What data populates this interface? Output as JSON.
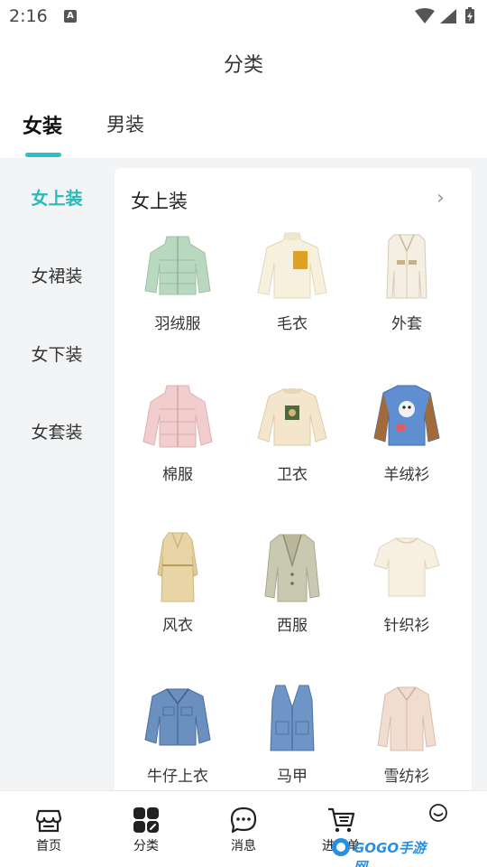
{
  "status_bar": {
    "time": "2:16",
    "notification_glyph": "A"
  },
  "header": {
    "title": "分类"
  },
  "tabs": [
    {
      "label": "女装",
      "active": true
    },
    {
      "label": "男装",
      "active": false
    }
  ],
  "sidebar": {
    "items": [
      {
        "label": "女上装",
        "active": true
      },
      {
        "label": "女裙装",
        "active": false
      },
      {
        "label": "女下装",
        "active": false
      },
      {
        "label": "女套装",
        "active": false
      }
    ]
  },
  "panel": {
    "title": "女上装",
    "more_icon": "chevron-right-icon",
    "categories": [
      {
        "label": "羽绒服",
        "icon": "down-jacket-icon"
      },
      {
        "label": "毛衣",
        "icon": "sweater-icon"
      },
      {
        "label": "外套",
        "icon": "coat-icon"
      },
      {
        "label": "棉服",
        "icon": "padded-jacket-icon"
      },
      {
        "label": "卫衣",
        "icon": "sweatshirt-icon"
      },
      {
        "label": "羊绒衫",
        "icon": "cashmere-sweater-icon"
      },
      {
        "label": "风衣",
        "icon": "trench-coat-icon"
      },
      {
        "label": "西服",
        "icon": "blazer-icon"
      },
      {
        "label": "针织衫",
        "icon": "knit-top-icon"
      },
      {
        "label": "牛仔上衣",
        "icon": "denim-jacket-icon"
      },
      {
        "label": "马甲",
        "icon": "vest-icon"
      },
      {
        "label": "雪纺衫",
        "icon": "chiffon-shirt-icon"
      }
    ]
  },
  "bottom_nav": {
    "items": [
      {
        "label": "首页",
        "icon": "store-icon"
      },
      {
        "label": "分类",
        "icon": "grid-icon",
        "active": true
      },
      {
        "label": "消息",
        "icon": "chat-icon"
      },
      {
        "label": "进货单",
        "icon": "cart-icon"
      },
      {
        "label": "",
        "icon": "smile-icon"
      }
    ]
  },
  "watermark": {
    "text": "GOGO手游网"
  },
  "colors": {
    "accent": "#2cc0c2",
    "background": "#f3f4f6"
  }
}
